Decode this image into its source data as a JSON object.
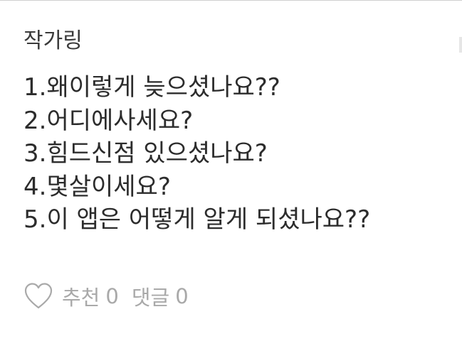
{
  "post": {
    "author": "작가링",
    "lines": [
      "1.왜이렇게 늦으셨나요??",
      "2.어디에사세요?",
      "3.힘드신점 있으셨나요?",
      "4.몇살이세요?",
      "5.이 앱은 어떻게 알게 되셨나요??"
    ]
  },
  "footer": {
    "like_icon": "heart-outline-icon",
    "like_label": "추천",
    "like_count": "0",
    "comment_label": "댓글",
    "comment_count": "0"
  },
  "colors": {
    "text": "#2c2c2c",
    "muted": "#a9a9a9",
    "background": "#ffffff"
  }
}
